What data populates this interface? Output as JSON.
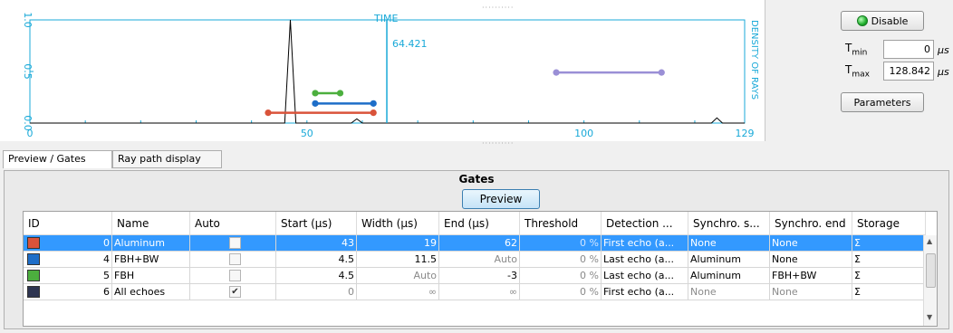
{
  "plot": {
    "top_label": "TIME",
    "right_label": "DENSITY OF RAYS",
    "cursor_value": "64.421",
    "y_ticks": [
      "0.0",
      "0.5",
      "1.0"
    ],
    "x_ticks": [
      "0",
      "50",
      "100",
      "129"
    ],
    "x_range": [
      0,
      129
    ],
    "y_range": [
      0,
      1
    ],
    "cursor_x": 64.421,
    "trace": [
      [
        0,
        0
      ],
      [
        46,
        0
      ],
      [
        47,
        1.0
      ],
      [
        48,
        0
      ],
      [
        58,
        0
      ],
      [
        59,
        0.04
      ],
      [
        60,
        0
      ],
      [
        123,
        0
      ],
      [
        124,
        0.05
      ],
      [
        125,
        0
      ],
      [
        129,
        0
      ]
    ],
    "gate_bars": [
      {
        "color": "#d9533a",
        "x1": 43,
        "x2": 62,
        "y": 0.1
      },
      {
        "color": "#1e6ec8",
        "x1": 51.5,
        "x2": 62,
        "y": 0.19
      },
      {
        "color": "#4caf3e",
        "x1": 51.5,
        "x2": 56,
        "y": 0.29
      },
      {
        "color": "#9a8fd6",
        "x1": 95,
        "x2": 114,
        "y": 0.49
      }
    ]
  },
  "controls": {
    "disable_label": "Disable",
    "status_color": "#2ecc40",
    "tmin_label": "T",
    "tmin_sub": "min",
    "tmin_value": "0",
    "tmax_label": "T",
    "tmax_sub": "max",
    "tmax_value": "128.842",
    "unit": "µs",
    "parameters_label": "Parameters"
  },
  "tabs": [
    {
      "label": "Preview / Gates"
    },
    {
      "label": "Ray path display"
    }
  ],
  "gates": {
    "title": "Gates",
    "preview_label": "Preview",
    "columns": [
      "ID",
      "Name",
      "Auto",
      "Start (µs)",
      "Width (µs)",
      "End (µs)",
      "Threshold",
      "Detection ...",
      "Synchro. s...",
      "Synchro. end",
      "Storage"
    ],
    "rows": [
      {
        "color": "#d9533a",
        "id": "0",
        "name": "Aluminum",
        "auto": "",
        "start": "43",
        "width": "19",
        "end": "62",
        "threshold": "0 %",
        "detection": "First echo (a...",
        "sync_start": "None",
        "sync_end": "None",
        "storage": "Σ"
      },
      {
        "color": "#1e6ec8",
        "id": "4",
        "name": "FBH+BW",
        "auto": "",
        "start": "4.5",
        "width": "11.5",
        "end": "Auto",
        "threshold": "0 %",
        "detection": "Last echo (a...",
        "sync_start": "Aluminum",
        "sync_end": "None",
        "storage": "Σ"
      },
      {
        "color": "#4caf3e",
        "id": "5",
        "name": "FBH",
        "auto": "",
        "start": "4.5",
        "width": "Auto",
        "end": "-3",
        "threshold": "0 %",
        "detection": "Last echo (a...",
        "sync_start": "Aluminum",
        "sync_end": "FBH+BW",
        "storage": "Σ"
      },
      {
        "color": "#2d3450",
        "id": "6",
        "name": "All echoes",
        "auto": "✔",
        "start": "0",
        "width": "∞",
        "end": "∞",
        "threshold": "0 %",
        "detection": "First echo (a...",
        "sync_start": "None",
        "sync_end": "None",
        "storage": "Σ"
      }
    ]
  }
}
